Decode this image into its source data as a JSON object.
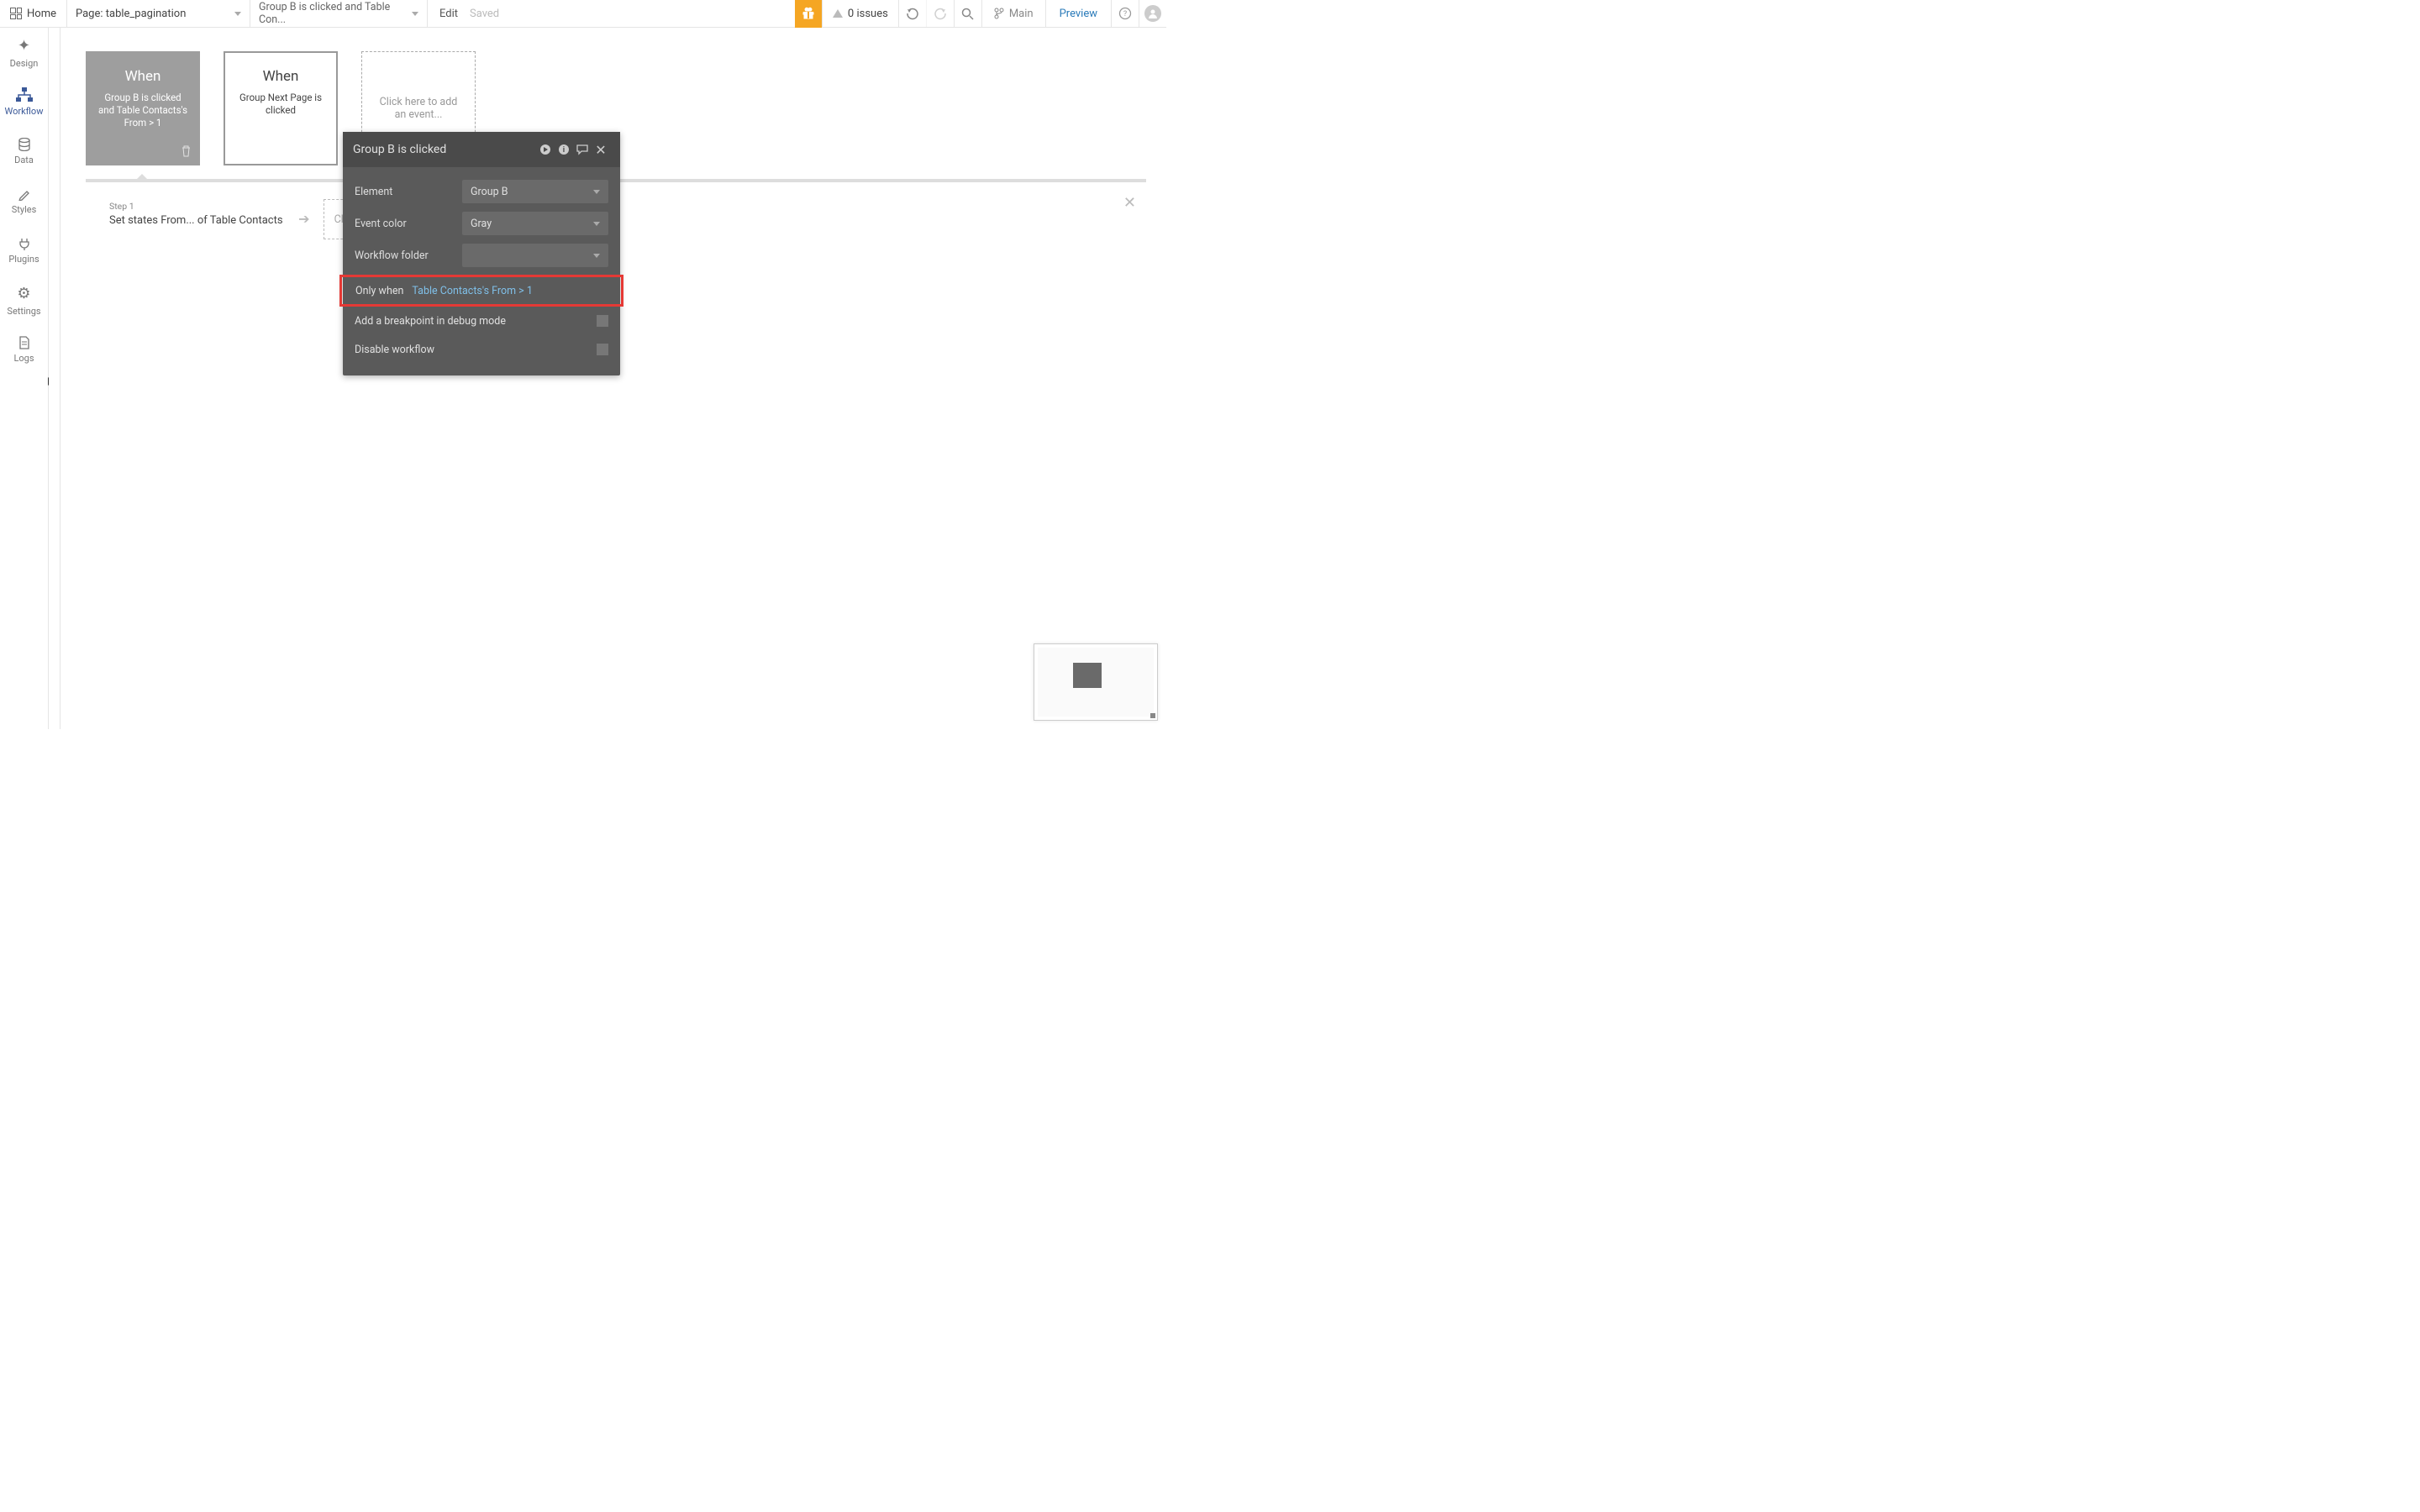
{
  "topbar": {
    "home": "Home",
    "page_label": "Page: table_pagination",
    "workflow_label": "Group B is clicked and Table Con...",
    "edit": "Edit",
    "saved": "Saved",
    "issues": "0 issues",
    "branch": "Main",
    "preview": "Preview"
  },
  "sidebar": {
    "items": [
      {
        "label": "Design"
      },
      {
        "label": "Workflow"
      },
      {
        "label": "Data"
      },
      {
        "label": "Styles"
      },
      {
        "label": "Plugins"
      },
      {
        "label": "Settings"
      },
      {
        "label": "Logs"
      }
    ]
  },
  "events": [
    {
      "when": "When",
      "desc": "Group B is clicked and Table Contacts's From > 1"
    },
    {
      "when": "When",
      "desc": "Group Next Page is clicked"
    }
  ],
  "add_event_label": "Click here to add an event...",
  "steps": {
    "step1_label": "Step 1",
    "step1_desc": "Set states From... of Table Contacts",
    "add_step": "Click he"
  },
  "panel": {
    "title": "Group B is clicked",
    "element_label": "Element",
    "element_value": "Group B",
    "color_label": "Event color",
    "color_value": "Gray",
    "folder_label": "Workflow folder",
    "folder_value": "",
    "only_when_label": "Only when",
    "only_when_value": "Table Contacts's From > 1",
    "breakpoint_label": "Add a breakpoint in debug mode",
    "disable_label": "Disable workflow"
  }
}
